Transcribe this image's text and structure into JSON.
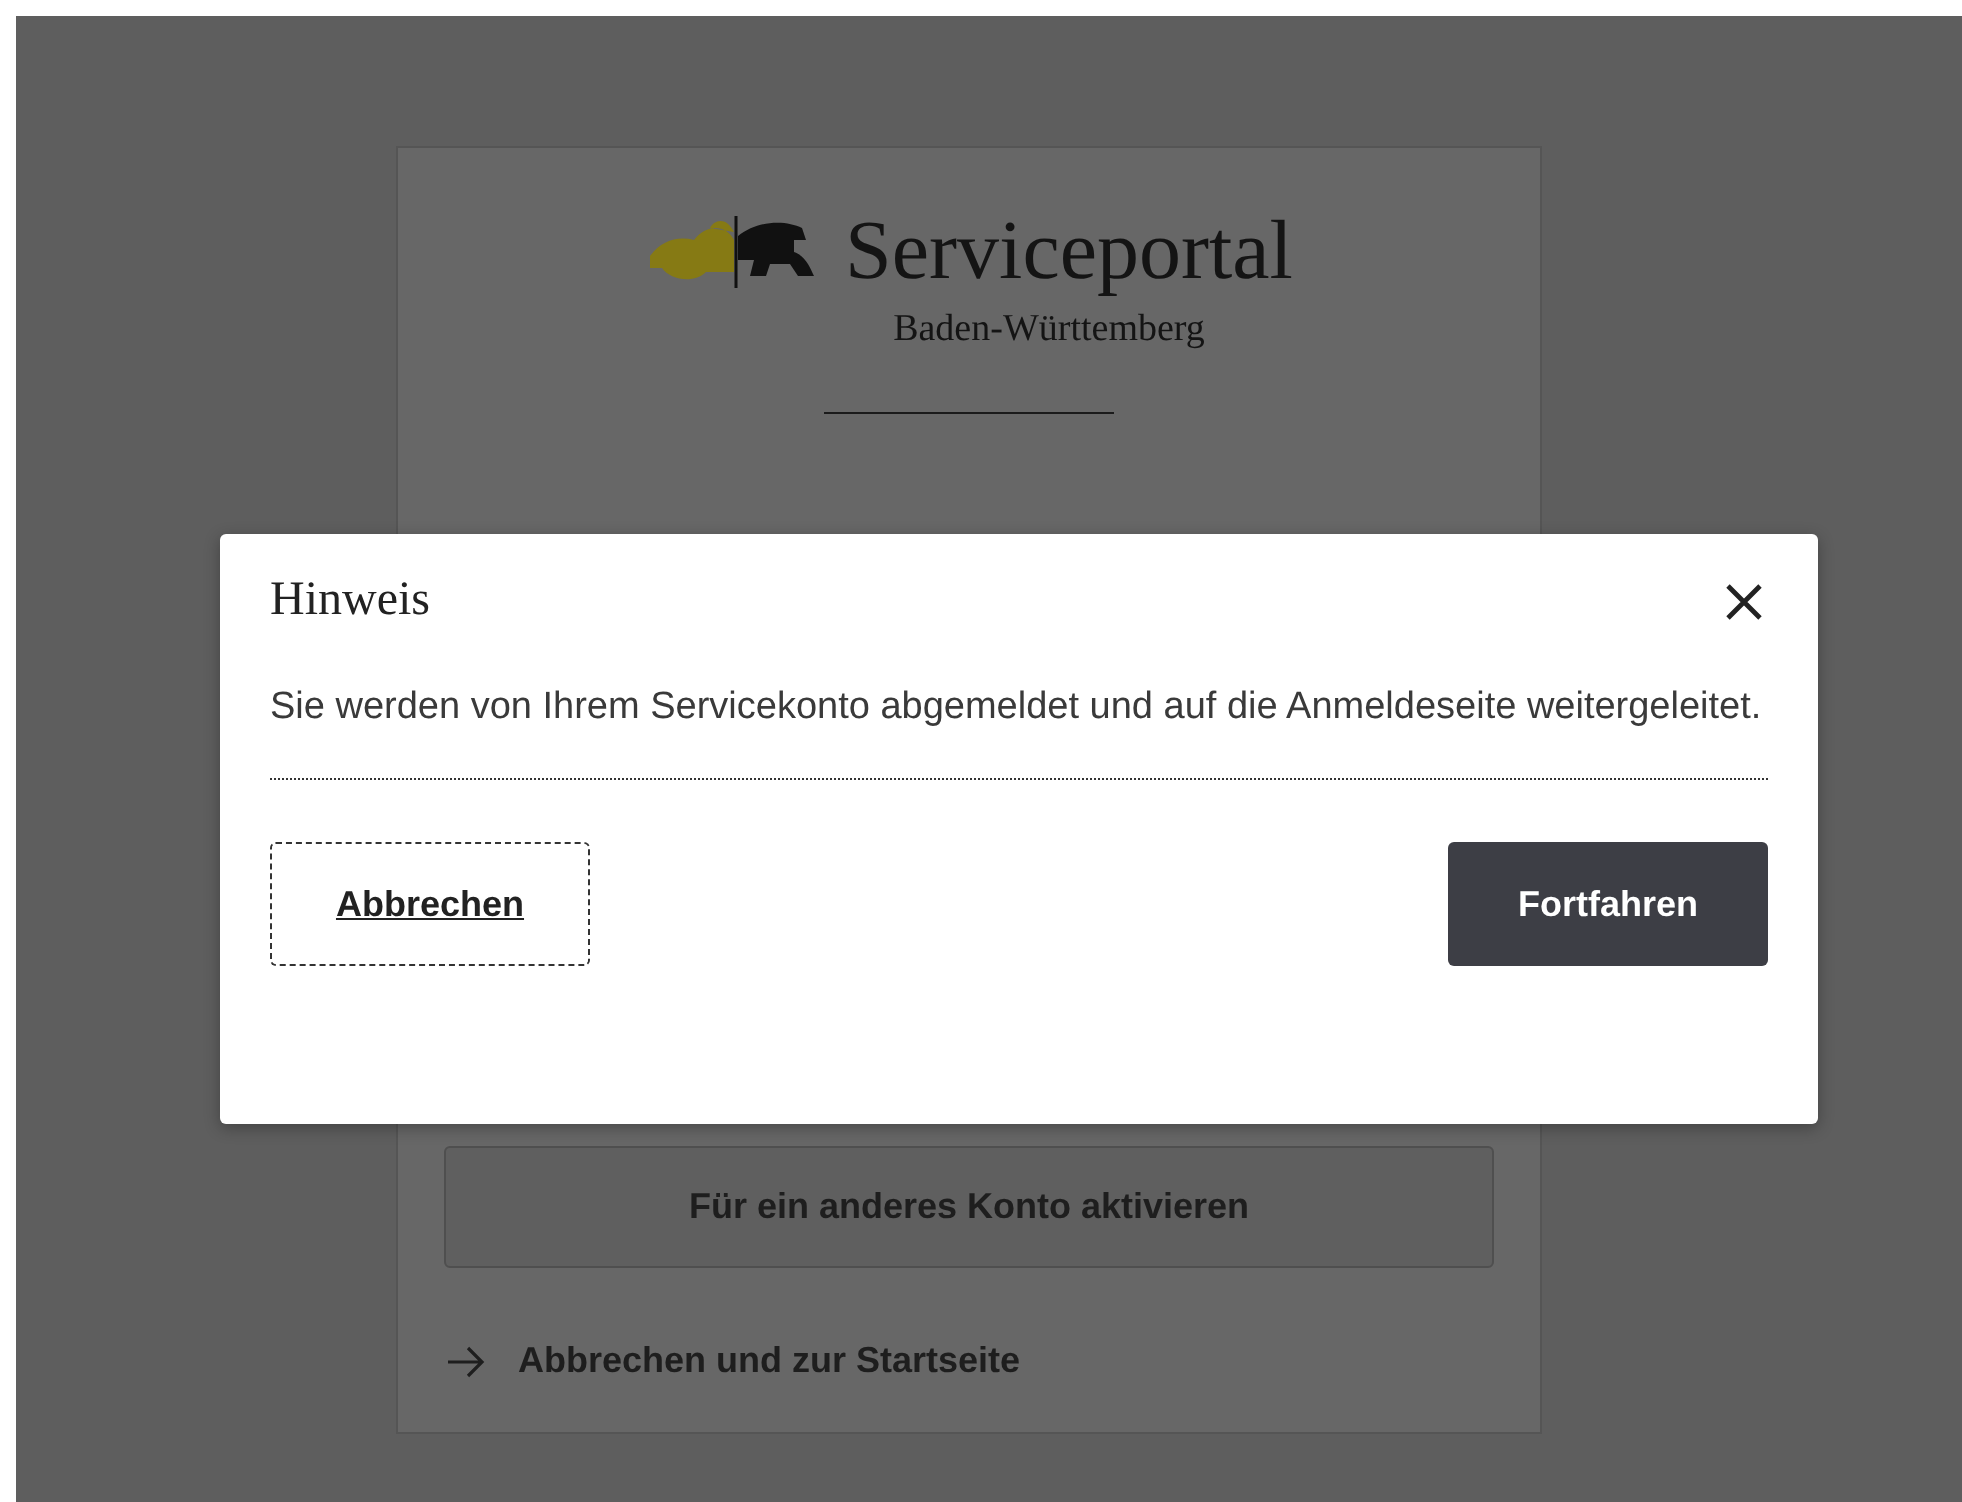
{
  "header": {
    "title": "Serviceportal",
    "subtitle": "Baden-Württemberg"
  },
  "page_actions": [
    {
      "kind": "button",
      "label": "Für ein anderes Konto aktivieren"
    },
    {
      "kind": "link",
      "label": "Abbrechen und zur Startseite"
    }
  ],
  "dialog": {
    "title": "Hinweis",
    "message": "Sie werden von Ihrem Servicekonto abgemeldet und auf die Anmeldeseite weitergeleitet.",
    "buttons": [
      {
        "kind": "secondary",
        "label": "Abbrechen"
      },
      {
        "kind": "primary",
        "label": "Fortfahren"
      }
    ]
  }
}
